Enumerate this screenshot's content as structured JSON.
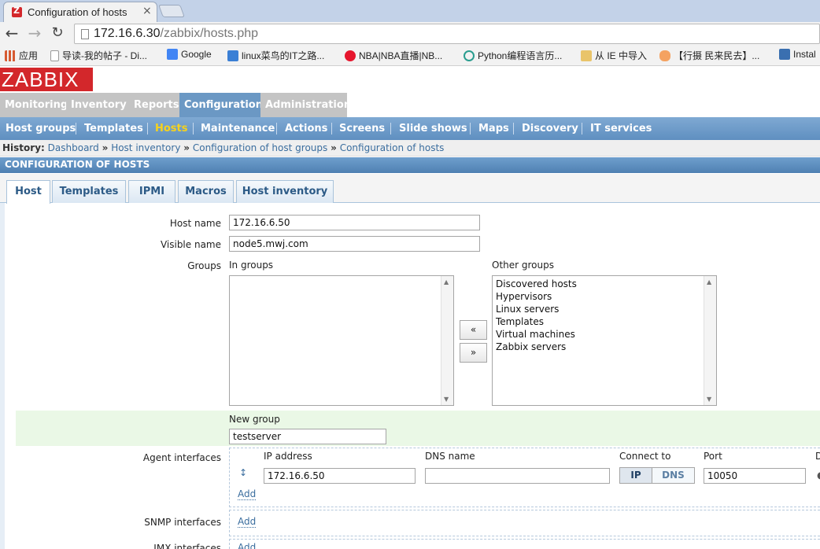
{
  "browser": {
    "tab_title": "Configuration of hosts",
    "tab_close": "×",
    "url_host": "172.16.6.30",
    "url_path": "/zabbix/hosts.php",
    "bookmarks": [
      {
        "label": "应用",
        "icon": "apps-icon",
        "color": "#d65a31"
      },
      {
        "label": "导读-我的帖子 - Di...",
        "icon": "page-icon",
        "color": "#ffffff"
      },
      {
        "label": "Google",
        "icon": "google-icon",
        "color": "#4285f4"
      },
      {
        "label": "linux菜鸟的IT之路...",
        "icon": "blog-icon",
        "color": "#3a7fd5"
      },
      {
        "label": "NBA|NBA直播|NB...",
        "icon": "weibo-icon",
        "color": "#e6162d"
      },
      {
        "label": "Python编程语言历...",
        "icon": "play-icon",
        "color": "#2a9d8f"
      },
      {
        "label": "从 IE 中导入",
        "icon": "folder-icon",
        "color": "#e9c46a"
      },
      {
        "label": "【行摄 民来民去】...",
        "icon": "hand-icon",
        "color": "#f4a261"
      },
      {
        "label": "Instal",
        "icon": "home-icon",
        "color": "#3a6fb0"
      }
    ]
  },
  "app": {
    "logo": "ZABBIX",
    "main_menu": [
      "Monitoring",
      "Inventory",
      "Reports",
      "Configuration",
      "Administration"
    ],
    "main_menu_active": "Configuration",
    "sub_menu": [
      "Host groups",
      "Templates",
      "Hosts",
      "Maintenance",
      "Actions",
      "Screens",
      "Slide shows",
      "Maps",
      "Discovery",
      "IT services"
    ],
    "sub_menu_active": "Hosts",
    "history_label": "History:",
    "history": [
      "Dashboard",
      "Host inventory",
      "Configuration of host groups",
      "Configuration of hosts"
    ],
    "history_sep": "»",
    "section_title": "CONFIGURATION OF HOSTS",
    "form_tabs": [
      "Host",
      "Templates",
      "IPMI",
      "Macros",
      "Host inventory"
    ],
    "form_tab_active": "Host"
  },
  "form": {
    "host_name_label": "Host name",
    "host_name": "172.16.6.50",
    "visible_name_label": "Visible name",
    "visible_name": "node5.mwj.com",
    "groups_label": "Groups",
    "in_groups_label": "In groups",
    "in_groups": [],
    "other_groups_label": "Other groups",
    "other_groups": [
      "Discovered hosts",
      "Hypervisors",
      "Linux servers",
      "Templates",
      "Virtual machines",
      "Zabbix servers"
    ],
    "move_left": "«",
    "move_right": "»",
    "new_group_label": "New group",
    "new_group": "testserver",
    "agent_interfaces_label": "Agent interfaces",
    "ip_address_header": "IP address",
    "dns_name_header": "DNS name",
    "connect_to_header": "Connect to",
    "port_header": "Port",
    "default_header_clip": "D",
    "agent_ip": "172.16.6.50",
    "agent_dns": "",
    "connect_ip": "IP",
    "connect_dns": "DNS",
    "agent_port": "10050",
    "add": "Add",
    "snmp_interfaces_label": "SNMP interfaces",
    "jmx_interfaces_label": "JMX interfaces"
  }
}
